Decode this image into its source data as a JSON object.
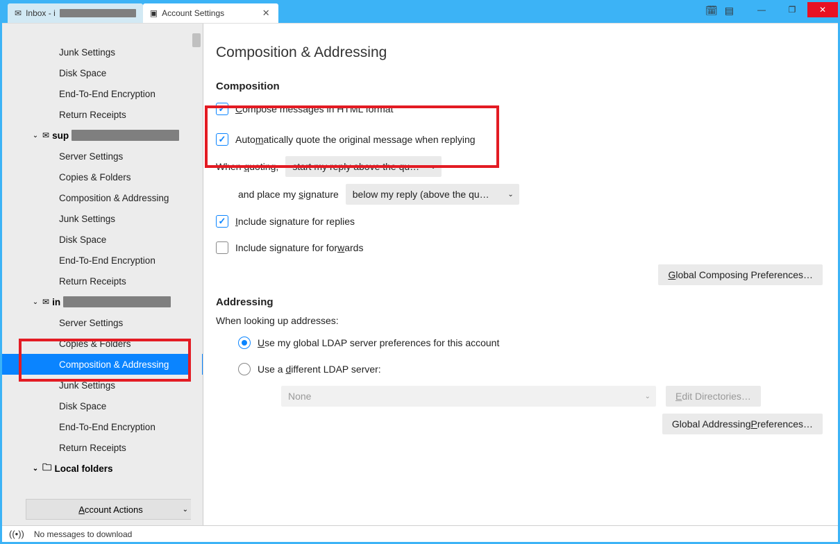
{
  "tabs": {
    "inbox_prefix": "Inbox - i",
    "settings_label": "Account Settings"
  },
  "sidebar": {
    "items_a": [
      "Junk Settings",
      "Disk Space",
      "End-To-End Encryption",
      "Return Receipts"
    ],
    "account_b_prefix": "sup",
    "items_b": [
      "Server Settings",
      "Copies & Folders",
      "Composition & Addressing",
      "Junk Settings",
      "Disk Space",
      "End-To-End Encryption",
      "Return Receipts"
    ],
    "account_c_prefix": "in",
    "items_c": [
      "Server Settings",
      "Copies & Folders",
      "Composition & Addressing",
      "Junk Settings",
      "Disk Space",
      "End-To-End Encryption",
      "Return Receipts"
    ],
    "local_folders": "Local folders",
    "account_actions": "Account Actions"
  },
  "page": {
    "title": "Composition & Addressing",
    "composition_h": "Composition",
    "compose_html": "ompose messages in HTML format",
    "auto_quote": "atically quote the original message when replying",
    "when_quoting": "uoting,",
    "reply_select": "start my reply above the qu…",
    "place_signature": "ignature",
    "signature_select": "below my reply (above the qu…",
    "inc_sig_replies": "nclude signature for replies",
    "inc_sig_forwards": "Include signature for for",
    "global_compose": "lobal Composing Preferences…",
    "addressing_h": "Addressing",
    "lookup_label": "When looking up addresses:",
    "use_global_ldap": "se my global LDAP server preferences for this account",
    "use_diff_ldap": "ifferent LDAP server:",
    "ldap_none": "None",
    "edit_dirs": "dit Directories…",
    "global_addr": "references…"
  },
  "status": {
    "msg": "No messages to download"
  }
}
